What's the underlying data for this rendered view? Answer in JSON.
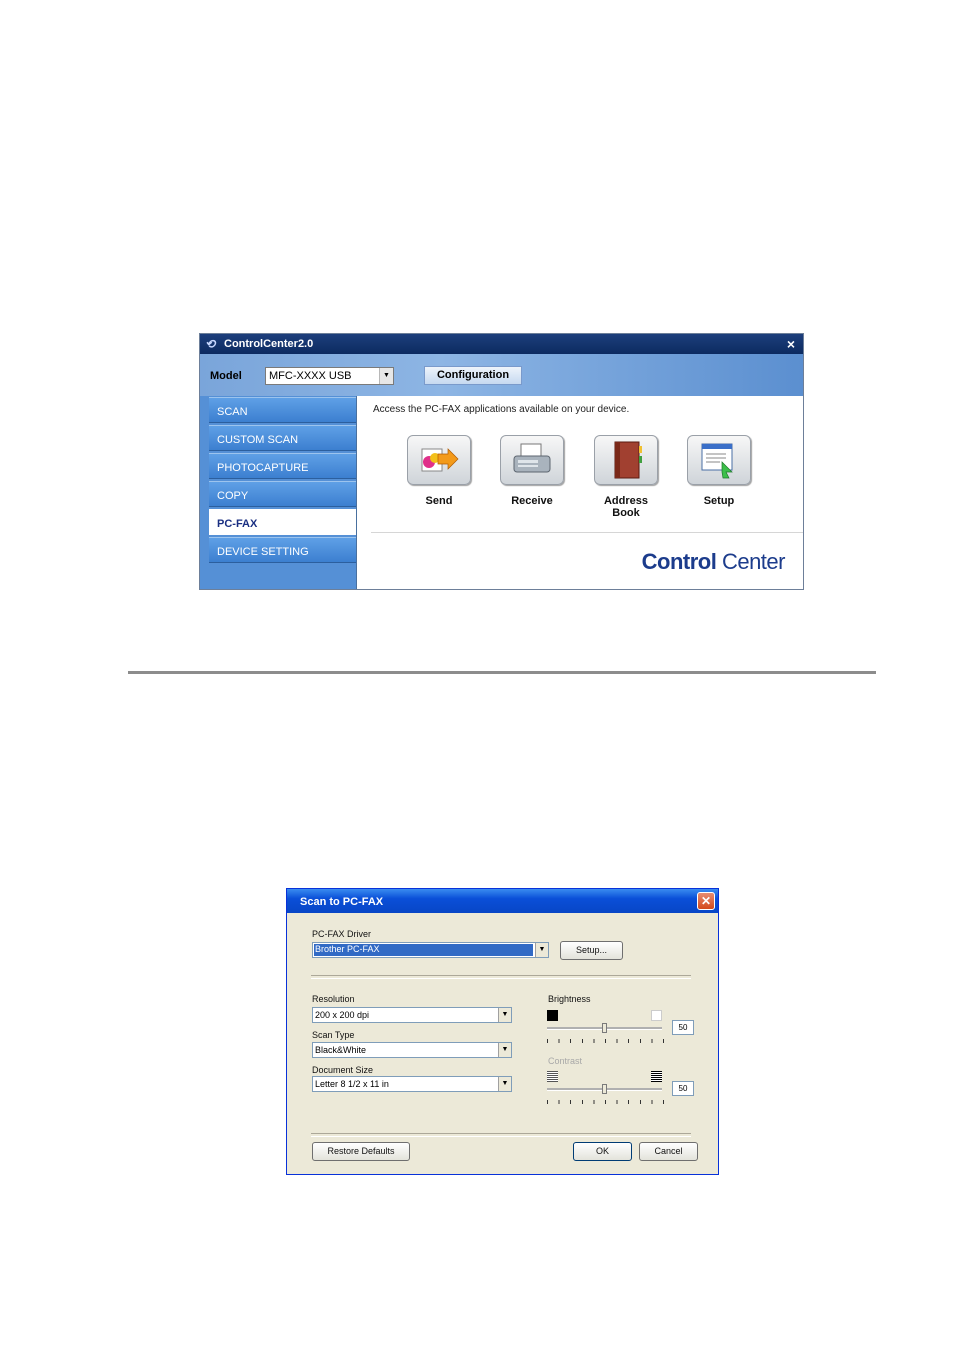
{
  "control_center": {
    "title": "ControlCenter2.0",
    "close_glyph": "×",
    "model_label": "Model",
    "model_value": "MFC-XXXX USB",
    "configuration_label": "Configuration",
    "sidebar": [
      {
        "label": "SCAN"
      },
      {
        "label": "CUSTOM SCAN"
      },
      {
        "label": "PHOTOCAPTURE"
      },
      {
        "label": "COPY"
      },
      {
        "label": "PC-FAX"
      },
      {
        "label": "DEVICE SETTING"
      }
    ],
    "active_tab": "PC-FAX",
    "message": "Access the  PC-FAX  applications available on your device.",
    "apps": [
      {
        "label": "Send",
        "icon": "send-icon"
      },
      {
        "label": "Receive",
        "icon": "receive-fax-icon"
      },
      {
        "label": "Address Book",
        "icon": "address-book-icon"
      },
      {
        "label": "Setup",
        "icon": "setup-icon"
      }
    ],
    "brand_part1": "Control",
    "brand_part2": "Center"
  },
  "dialog": {
    "title": "Scan to PC-FAX",
    "close_glyph": "✕",
    "driver_label": "PC-FAX Driver",
    "driver_value": "Brother PC-FAX",
    "setup_button": "Setup...",
    "resolution_label": "Resolution",
    "resolution_value": "200 x 200 dpi",
    "scan_type_label": "Scan Type",
    "scan_type_value": "Black&White",
    "document_size_label": "Document Size",
    "document_size_value": "Letter 8 1/2 x 11 in",
    "brightness_label": "Brightness",
    "brightness_value": "50",
    "contrast_label": "Contrast",
    "contrast_value": "50",
    "restore_defaults": "Restore Defaults",
    "ok": "OK",
    "cancel": "Cancel"
  },
  "colors": {
    "cc_title_bar": "#0c2a60",
    "cc_sidebar": "#3c7fd0",
    "brand": "#1c3c8c",
    "dialog_title_bar": "#0846c6",
    "dialog_body": "#ece9d8"
  }
}
